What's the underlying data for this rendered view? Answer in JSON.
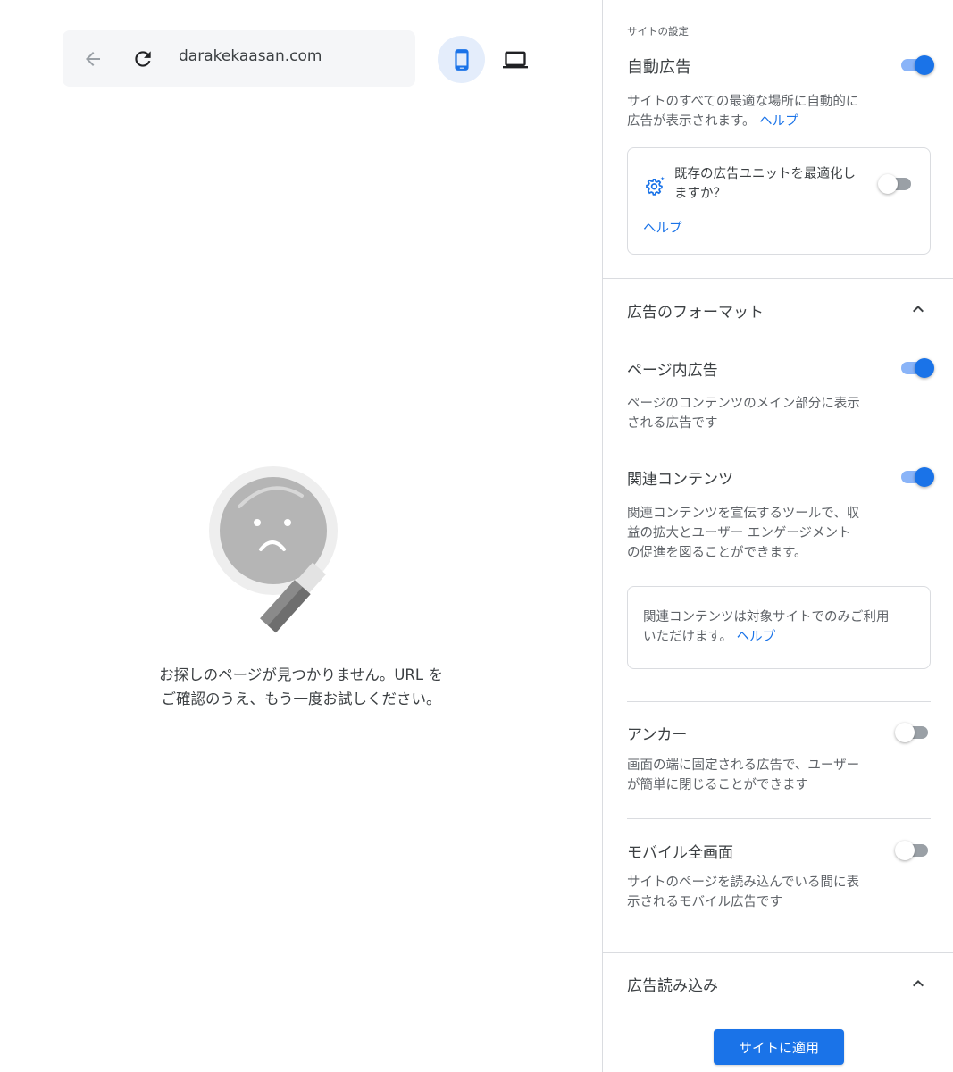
{
  "browser": {
    "url": "darakekaasan.com",
    "back_icon": "arrow-back-icon",
    "reload_icon": "reload-icon",
    "mobile_icon": "smartphone-icon",
    "desktop_icon": "laptop-icon"
  },
  "not_found": {
    "line1": "お探しのページが見つかりません。URL を",
    "line2": "ご確認のうえ、もう一度お試しください。"
  },
  "panel": {
    "site_settings_label": "サイトの設定",
    "auto_ads": {
      "title": "自動広告",
      "enabled": true,
      "desc_line1": "サイトのすべての最適な場所に自動的に",
      "desc_line2": "広告が表示されます。",
      "help": "ヘルプ"
    },
    "optimize_card": {
      "text_line1": "既存の広告ユニットを最適化し",
      "text_line2": "ますか？",
      "enabled": false,
      "help": "ヘルプ"
    },
    "ad_formats": {
      "title": "広告のフォーマット",
      "in_page": {
        "title": "ページ内広告",
        "enabled": true,
        "desc_line1": "ページのコンテンツのメイン部分に表示",
        "desc_line2": "される広告です"
      },
      "related": {
        "title": "関連コンテンツ",
        "enabled": true,
        "desc_line1": "関連コンテンツを宣伝するツールで、収",
        "desc_line2": "益の拡大とユーザー エンゲージメント",
        "desc_line3": "の促進を図ることができます。",
        "note_line1": "関連コンテンツは対象サイトでのみご利用",
        "note_line2": "いただけます。",
        "note_help": "ヘルプ"
      },
      "anchor": {
        "title": "アンカー",
        "enabled": false,
        "desc_line1": "画面の端に固定される広告で、ユーザー",
        "desc_line2": "が簡単に閉じることができます"
      },
      "vignette": {
        "title": "モバイル全画面",
        "enabled": false,
        "desc_line1": "サイトのページを読み込んでいる間に表",
        "desc_line2": "示されるモバイル広告です"
      }
    },
    "ad_load": {
      "title": "広告読み込み"
    },
    "apply_button": "サイトに適用"
  },
  "colors": {
    "accent": "#1a73e8",
    "toggle_track_on": "#8ab4f8",
    "divider": "#dadce0"
  }
}
